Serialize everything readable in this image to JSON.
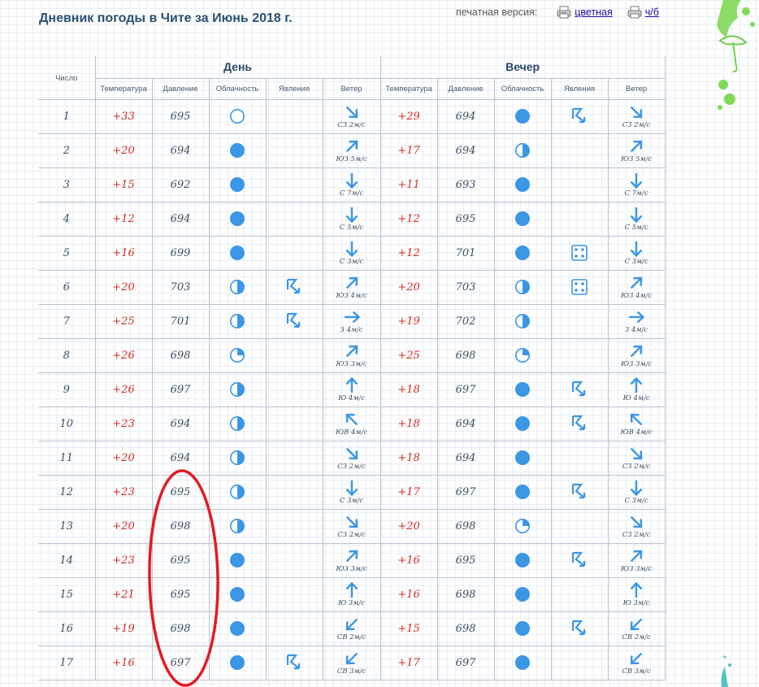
{
  "title": "Дневник погоды в Чите за Июнь 2018 г.",
  "print": {
    "label": "печатная версия:",
    "color_link": "цветная",
    "bw_link": "ч/б"
  },
  "headers": {
    "number": "Число",
    "day": "День",
    "evening": "Вечер",
    "columns": [
      "Температура",
      "Давление",
      "Облачность",
      "Явления",
      "Ветер"
    ]
  },
  "rows": [
    {
      "n": "1",
      "day": {
        "t": "+33",
        "p": "695",
        "c": "clear",
        "ph": "",
        "wd": "NW",
        "ws": "СЗ 2м/с"
      },
      "eve": {
        "t": "+29",
        "p": "694",
        "c": "overcast",
        "ph": "thunder",
        "wd": "NW",
        "ws": "СЗ 2м/с"
      }
    },
    {
      "n": "2",
      "day": {
        "t": "+20",
        "p": "694",
        "c": "overcast",
        "ph": "",
        "wd": "SW",
        "ws": "ЮЗ 5м/с"
      },
      "eve": {
        "t": "+17",
        "p": "694",
        "c": "half",
        "ph": "",
        "wd": "SW",
        "ws": "ЮЗ 5м/с"
      }
    },
    {
      "n": "3",
      "day": {
        "t": "+15",
        "p": "692",
        "c": "overcast",
        "ph": "",
        "wd": "N",
        "ws": "С 7м/с"
      },
      "eve": {
        "t": "+11",
        "p": "693",
        "c": "overcast",
        "ph": "",
        "wd": "N",
        "ws": "С 7м/с"
      }
    },
    {
      "n": "4",
      "day": {
        "t": "+12",
        "p": "694",
        "c": "overcast",
        "ph": "",
        "wd": "N",
        "ws": "С 5м/с"
      },
      "eve": {
        "t": "+12",
        "p": "695",
        "c": "overcast",
        "ph": "",
        "wd": "N",
        "ws": "С 5м/с"
      }
    },
    {
      "n": "5",
      "day": {
        "t": "+16",
        "p": "699",
        "c": "overcast",
        "ph": "",
        "wd": "N",
        "ws": "С 3м/с"
      },
      "eve": {
        "t": "+12",
        "p": "701",
        "c": "overcast",
        "ph": "hail",
        "wd": "N",
        "ws": "С 3м/с"
      }
    },
    {
      "n": "6",
      "day": {
        "t": "+20",
        "p": "703",
        "c": "half",
        "ph": "thunder",
        "wd": "SW",
        "ws": "ЮЗ 4м/с"
      },
      "eve": {
        "t": "+20",
        "p": "703",
        "c": "half",
        "ph": "hail",
        "wd": "SW",
        "ws": "ЮЗ 4м/с"
      }
    },
    {
      "n": "7",
      "day": {
        "t": "+25",
        "p": "701",
        "c": "half",
        "ph": "thunder",
        "wd": "W",
        "ws": "З 4м/с"
      },
      "eve": {
        "t": "+19",
        "p": "702",
        "c": "half",
        "ph": "",
        "wd": "W",
        "ws": "З 4м/с"
      }
    },
    {
      "n": "8",
      "day": {
        "t": "+26",
        "p": "698",
        "c": "quarter",
        "ph": "",
        "wd": "SW",
        "ws": "ЮЗ 3м/с"
      },
      "eve": {
        "t": "+25",
        "p": "698",
        "c": "quarter",
        "ph": "",
        "wd": "SW",
        "ws": "ЮЗ 3м/с"
      }
    },
    {
      "n": "9",
      "day": {
        "t": "+26",
        "p": "697",
        "c": "half",
        "ph": "",
        "wd": "S",
        "ws": "Ю 4м/с"
      },
      "eve": {
        "t": "+18",
        "p": "697",
        "c": "overcast",
        "ph": "thunder",
        "wd": "S",
        "ws": "Ю 4м/с"
      }
    },
    {
      "n": "10",
      "day": {
        "t": "+23",
        "p": "694",
        "c": "half",
        "ph": "",
        "wd": "SE",
        "ws": "ЮВ 4м/с"
      },
      "eve": {
        "t": "+18",
        "p": "694",
        "c": "overcast",
        "ph": "thunder",
        "wd": "SE",
        "ws": "ЮВ 4м/с"
      }
    },
    {
      "n": "11",
      "day": {
        "t": "+20",
        "p": "694",
        "c": "half",
        "ph": "",
        "wd": "NW",
        "ws": "СЗ 2м/с"
      },
      "eve": {
        "t": "+18",
        "p": "694",
        "c": "overcast",
        "ph": "",
        "wd": "NW",
        "ws": "СЗ 2м/с"
      }
    },
    {
      "n": "12",
      "day": {
        "t": "+23",
        "p": "695",
        "c": "half",
        "ph": "",
        "wd": "N",
        "ws": "С 3м/с"
      },
      "eve": {
        "t": "+17",
        "p": "697",
        "c": "overcast",
        "ph": "thunder",
        "wd": "N",
        "ws": "С 3м/с"
      }
    },
    {
      "n": "13",
      "day": {
        "t": "+20",
        "p": "698",
        "c": "half",
        "ph": "",
        "wd": "NW",
        "ws": "СЗ 2м/с"
      },
      "eve": {
        "t": "+20",
        "p": "698",
        "c": "quarter",
        "ph": "",
        "wd": "NW",
        "ws": "СЗ 2м/с"
      }
    },
    {
      "n": "14",
      "day": {
        "t": "+23",
        "p": "695",
        "c": "overcast",
        "ph": "",
        "wd": "SW",
        "ws": "ЮЗ 3м/с"
      },
      "eve": {
        "t": "+16",
        "p": "695",
        "c": "overcast",
        "ph": "thunder",
        "wd": "SW",
        "ws": "ЮЗ 3м/с"
      }
    },
    {
      "n": "15",
      "day": {
        "t": "+21",
        "p": "695",
        "c": "overcast",
        "ph": "",
        "wd": "S",
        "ws": "Ю 3м/с"
      },
      "eve": {
        "t": "+16",
        "p": "698",
        "c": "overcast",
        "ph": "",
        "wd": "S",
        "ws": "Ю 3м/с"
      }
    },
    {
      "n": "16",
      "day": {
        "t": "+19",
        "p": "698",
        "c": "overcast",
        "ph": "",
        "wd": "NE",
        "ws": "СВ 2м/с"
      },
      "eve": {
        "t": "+15",
        "p": "698",
        "c": "overcast",
        "ph": "thunder",
        "wd": "NE",
        "ws": "СВ 2м/с"
      }
    },
    {
      "n": "17",
      "day": {
        "t": "+16",
        "p": "697",
        "c": "overcast",
        "ph": "thunder",
        "wd": "NE",
        "ws": "СВ 3м/с"
      },
      "eve": {
        "t": "+17",
        "p": "697",
        "c": "overcast",
        "ph": "",
        "wd": "NE",
        "ws": "СВ 3м/с"
      }
    }
  ],
  "colors": {
    "icon_blue": "#3b96e6",
    "temp_red": "#d52b1e",
    "annotation_red": "#e31b23",
    "decor_green": "#7ed957"
  }
}
